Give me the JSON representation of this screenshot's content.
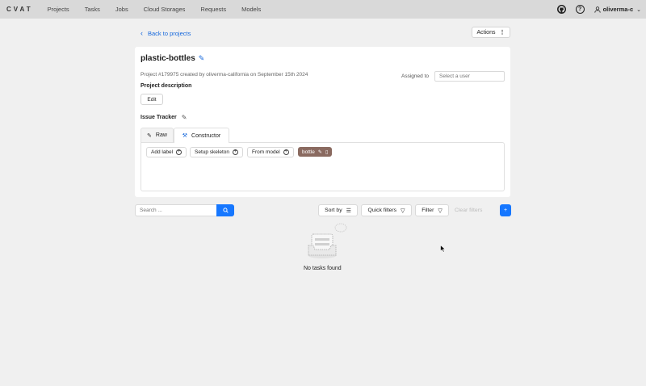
{
  "topbar": {
    "logo": "CVAT",
    "nav": [
      "Projects",
      "Tasks",
      "Jobs",
      "Cloud Storages",
      "Requests",
      "Models"
    ],
    "help_symbol": "?",
    "username": "oliverma-c"
  },
  "page": {
    "back_link": "Back to projects",
    "actions_label": "Actions"
  },
  "project": {
    "title": "plastic-bottles",
    "meta": "Project #179975 created by oliverma-california on September 15th 2024",
    "assigned_label": "Assigned to",
    "assigned_placeholder": "Select a user",
    "description_label": "Project description",
    "edit_label": "Edit",
    "issue_tracker_label": "Issue Tracker"
  },
  "labels": {
    "tabs": [
      {
        "label": "Raw",
        "icon": "edit-icon",
        "active": false
      },
      {
        "label": "Constructor",
        "icon": "build-icon",
        "active": true
      }
    ],
    "buttons": {
      "add_label": "Add label",
      "setup_skeleton": "Setup skeleton",
      "from_model": "From model"
    },
    "items": [
      {
        "name": "bottle",
        "color": "#8a6a60"
      }
    ]
  },
  "tasks_toolbar": {
    "search_placeholder": "Search ...",
    "sort_by": "Sort by",
    "quick_filters": "Quick filters",
    "filter": "Filter",
    "clear_filters": "Clear filters",
    "add_symbol": "+"
  },
  "empty_state": {
    "text": "No tasks found"
  },
  "colors": {
    "primary": "#1677ff",
    "link": "#1668dc",
    "topbar_bg": "#d9d9d9",
    "page_bg": "#f0f0f0"
  }
}
